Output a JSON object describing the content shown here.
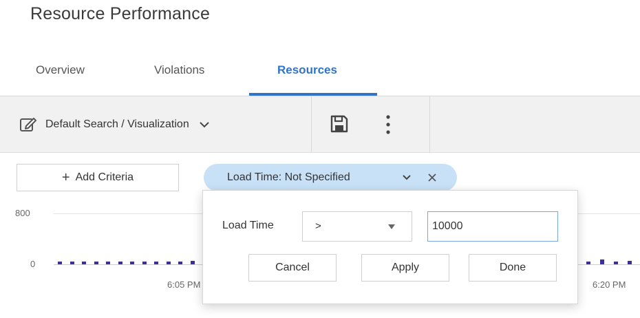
{
  "page": {
    "title": "Resource Performance"
  },
  "tabs": [
    {
      "label": "Overview",
      "active": false
    },
    {
      "label": "Violations",
      "active": false
    },
    {
      "label": "Resources",
      "active": true
    }
  ],
  "toolbar": {
    "search_label": "Default Search / Visualization",
    "icons": [
      "edit-icon",
      "chevron-down-icon",
      "save-icon",
      "more-vertical-icon"
    ]
  },
  "criteria": {
    "add_label": "Add Criteria",
    "pill_label": "Load Time: Not Specified"
  },
  "popover": {
    "field_label": "Load Time",
    "operator": ">",
    "value": "10000",
    "buttons": {
      "cancel": "Cancel",
      "apply": "Apply",
      "done": "Done"
    }
  },
  "chart_data": {
    "type": "bar",
    "y_ticks": [
      "800",
      "0"
    ],
    "ylim": [
      0,
      800
    ],
    "x_ticks": [
      "6:05 PM",
      "6:20 PM"
    ],
    "values_left": [
      20,
      20,
      15,
      20,
      70,
      15,
      55,
      20,
      30,
      75,
      45,
      95
    ],
    "values_right": [
      60,
      120,
      20,
      95
    ],
    "colors": {
      "bar": "#3b2f9c",
      "accent": "#2f74c8",
      "pill": "#c9e1f7"
    }
  }
}
